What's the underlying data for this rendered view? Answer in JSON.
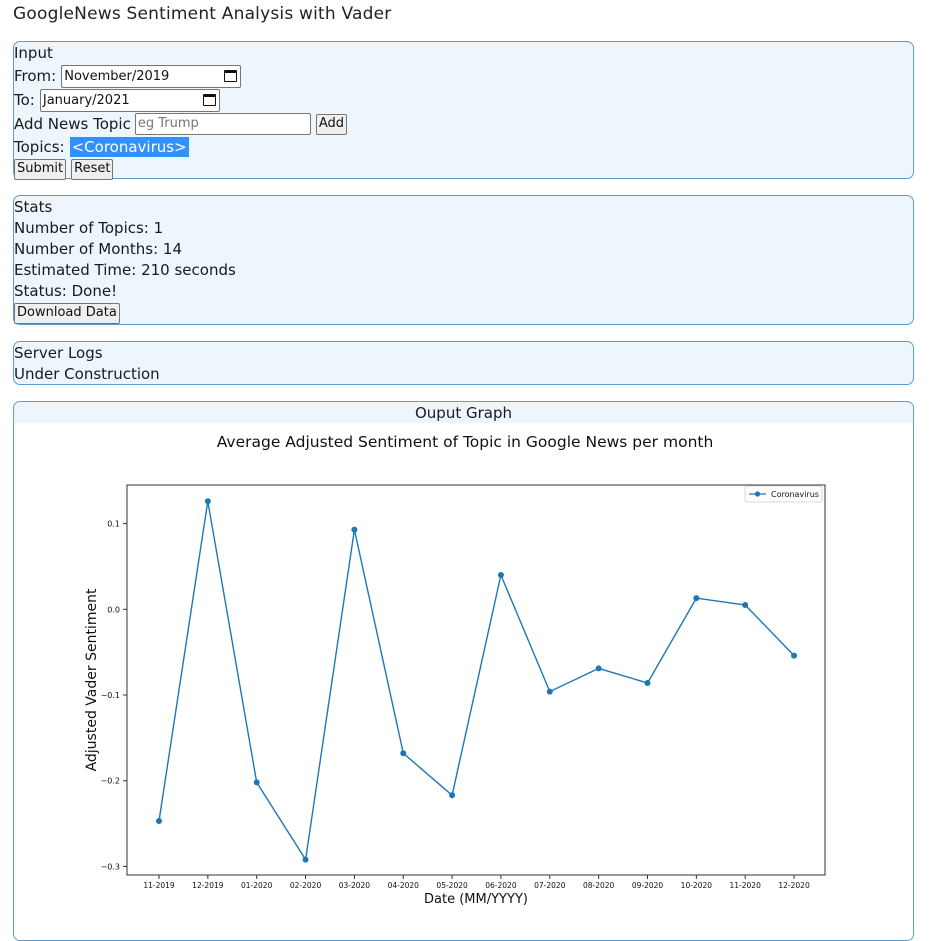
{
  "app": {
    "title": "GoogleNews Sentiment Analysis with Vader"
  },
  "input": {
    "heading": "Input",
    "from_label": "From:",
    "from_value": "November/2019",
    "to_label": "To:",
    "to_value": "January/2021",
    "add_topic_label": "Add News Topic",
    "add_topic_placeholder": "eg Trump",
    "add_button": "Add",
    "topics_label": "Topics:",
    "topics_value": "<Coronavirus>",
    "submit_button": "Submit",
    "reset_button": "Reset"
  },
  "stats": {
    "heading": "Stats",
    "topics": "Number of Topics: 1",
    "months": "Number of Months: 14",
    "time": "Estimated Time: 210 seconds",
    "status": "Status: Done!",
    "download_button": "Download Data"
  },
  "logs": {
    "heading": "Server Logs",
    "message": "Under Construction"
  },
  "graph": {
    "heading": "Ouput Graph"
  },
  "chart_data": {
    "type": "line",
    "title": "Average Adjusted Sentiment of Topic in Google News per month",
    "xlabel": "Date (MM/YYYY)",
    "ylabel": "Adjusted Vader Sentiment",
    "categories": [
      "11-2019",
      "12-2019",
      "01-2020",
      "02-2020",
      "03-2020",
      "04-2020",
      "05-2020",
      "06-2020",
      "07-2020",
      "08-2020",
      "09-2020",
      "10-2020",
      "11-2020",
      "12-2020"
    ],
    "series": [
      {
        "name": "Coronavirus",
        "color": "#1f77b4",
        "values": [
          -0.247,
          0.126,
          -0.202,
          -0.292,
          0.093,
          -0.168,
          -0.217,
          0.04,
          -0.096,
          -0.069,
          -0.086,
          0.013,
          0.005,
          -0.054
        ]
      }
    ],
    "yticks": [
      0.1,
      0.0,
      -0.1,
      -0.2,
      -0.3
    ],
    "ytick_labels": [
      "0.1",
      "0.0",
      "−0.1",
      "−0.2",
      "−0.3"
    ],
    "ylim": [
      -0.31,
      0.145
    ],
    "grid": false,
    "legend_position": "top-right"
  }
}
